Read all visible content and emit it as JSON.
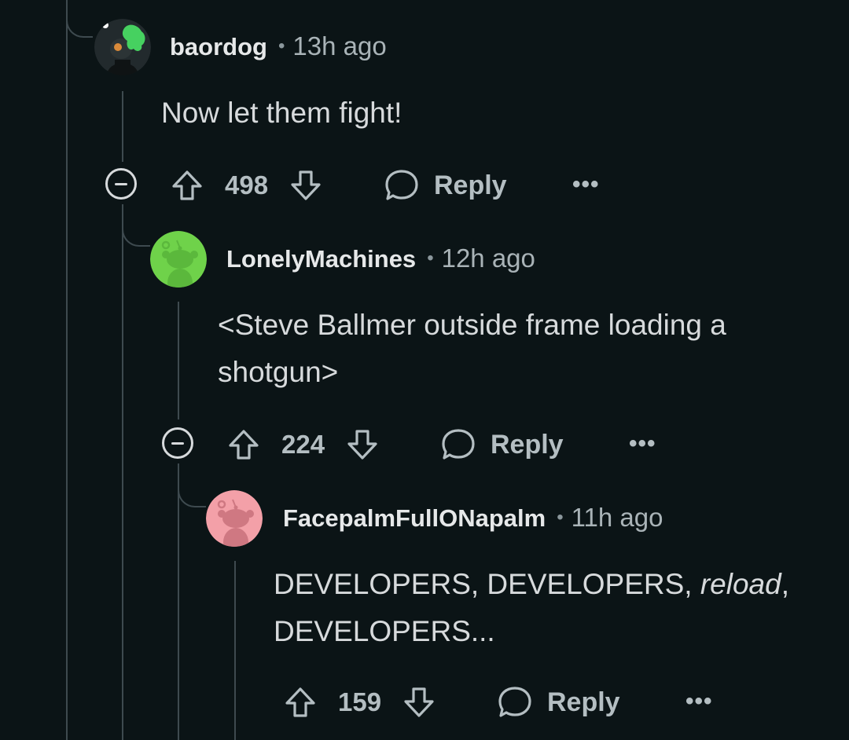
{
  "comments": [
    {
      "username": "baordog",
      "separator": "•",
      "time": "13h ago",
      "body_lines": [
        "Now let them fight!"
      ],
      "votes": "498",
      "reply_label": "Reply",
      "more_label": "•••",
      "avatar_color": "#222a2d",
      "accent_color": "#46d160"
    },
    {
      "username": "LonelyMachines",
      "separator": "•",
      "time": "12h ago",
      "body_lines": [
        "<Steve Ballmer outside frame loading a",
        "shotgun>"
      ],
      "votes": "224",
      "reply_label": "Reply",
      "more_label": "•••",
      "avatar_color": "#6fd24a"
    },
    {
      "username": "FacepalmFullONapalm",
      "separator": "•",
      "time": "11h ago",
      "body_line1_a": "DEVELOPERS, DEVELOPERS, ",
      "body_line1_em": "reload",
      "body_line1_b": ",",
      "body_line2": "DEVELOPERS...",
      "votes": "159",
      "reply_label": "Reply",
      "more_label": "•••",
      "avatar_color": "#f3a0a8"
    }
  ]
}
